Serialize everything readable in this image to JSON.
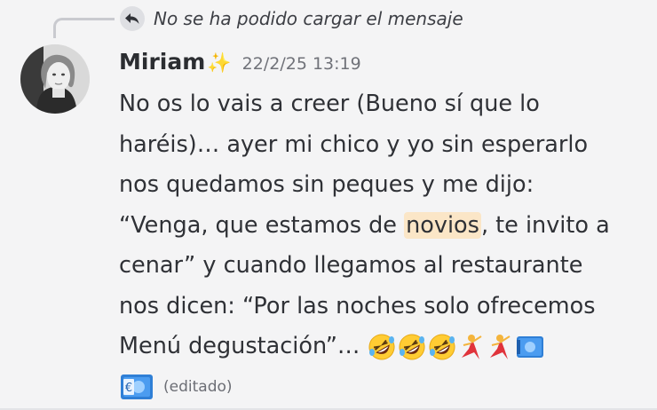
{
  "reply": {
    "text": "No se ha podido cargar el mensaje",
    "icon": "reply-arrow-icon"
  },
  "author": {
    "name": "Miriam",
    "badge": "✨",
    "avatar_icon": "user-avatar"
  },
  "timestamp": "22/2/25 13:19",
  "message": {
    "lines": {
      "l1": "No os lo vais a creer (Bueno sí que lo",
      "l2": "haréis)… ayer mi chico y yo sin esperarlo",
      "l3": "nos quedamos sin peques y me dijo:",
      "l4_before": "“Venga, que estamos de ",
      "l4_highlight": "novios",
      "l4_after": ", te invito a",
      "l5": "cenar” y cuando llegamos al restaurante",
      "l6": "nos dicen: “Por las noches solo ofrecemos",
      "l7": "Menú degustación”… "
    },
    "emojis": [
      "rolling-on-floor-laughing",
      "rolling-on-floor-laughing",
      "rolling-on-floor-laughing",
      "dancer",
      "dancer",
      "euro-banknote",
      "euro-banknote"
    ],
    "edited_label": "(editado)"
  },
  "colors": {
    "background": "#f4f4f5",
    "highlight": "#fbe6c7",
    "timestamp": "#707279"
  }
}
